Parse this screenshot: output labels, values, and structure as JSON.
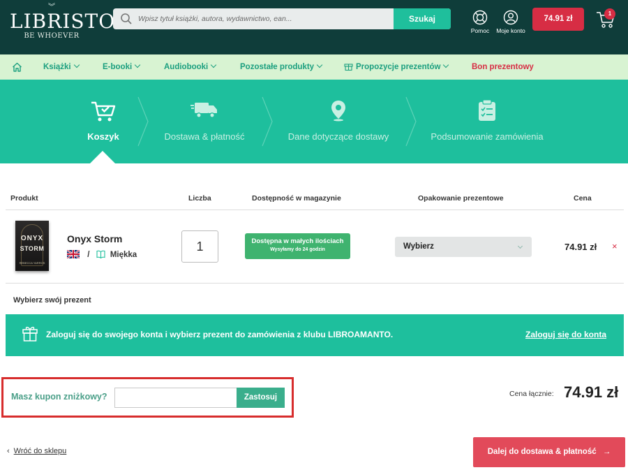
{
  "brand": {
    "name": "LIBRISTO",
    "tagline": "BE WHOEVER"
  },
  "search": {
    "placeholder": "Wpisz tytuł książki, autora, wydawnictwo, ean...",
    "button": "Szukaj"
  },
  "header": {
    "help": "Pomoc",
    "account": "Moje konto",
    "cart_total": "74.91 zł",
    "cart_count": "1"
  },
  "nav": {
    "items": [
      "Książki",
      "E-booki",
      "Audiobooki",
      "Pozostałe produkty",
      "Propozycje prezentów",
      "Bon prezentowy"
    ]
  },
  "steps": [
    "Koszyk",
    "Dostawa & płatność",
    "Dane dotyczące dostawy",
    "Podsumowanie zamówienia"
  ],
  "table": {
    "headers": [
      "Produkt",
      "Liczba",
      "Dostępność w magazynie",
      "Opakowanie prezentowe",
      "Cena"
    ]
  },
  "product": {
    "cover_title_1": "ONYX",
    "cover_title_2": "STORM",
    "cover_author": "REBECCA YARROS",
    "title": "Onyx Storm",
    "separator": "/",
    "format": "Miękka",
    "quantity": "1",
    "availability": "Dostępna w małych ilościach",
    "shipping": "Wysyłamy do 24 godzin",
    "gift_wrap": "Wybierz",
    "price": "74.91 zł",
    "remove": "×"
  },
  "gift": {
    "heading": "Wybierz swój prezent",
    "text": "Zaloguj się do swojego konta i wybierz prezent do zamówienia z klubu LIBROAMANTO.",
    "link": "Zaloguj się do konta"
  },
  "coupon": {
    "label": "Masz kupon zniżkowy?",
    "value": "",
    "button": "Zastosuj"
  },
  "total": {
    "label": "Cena łącznie:",
    "value": "74.91 zł"
  },
  "back": {
    "arrow": "‹",
    "label": "Wróć do sklepu"
  },
  "next": {
    "label": "Dalej do dostawa & płatność",
    "arrow": "→"
  },
  "colors": {
    "header_bg": "#0f3d3a",
    "accent": "#1ebf9d",
    "nav_bg": "#d8f3d2",
    "red": "#d72d44"
  }
}
